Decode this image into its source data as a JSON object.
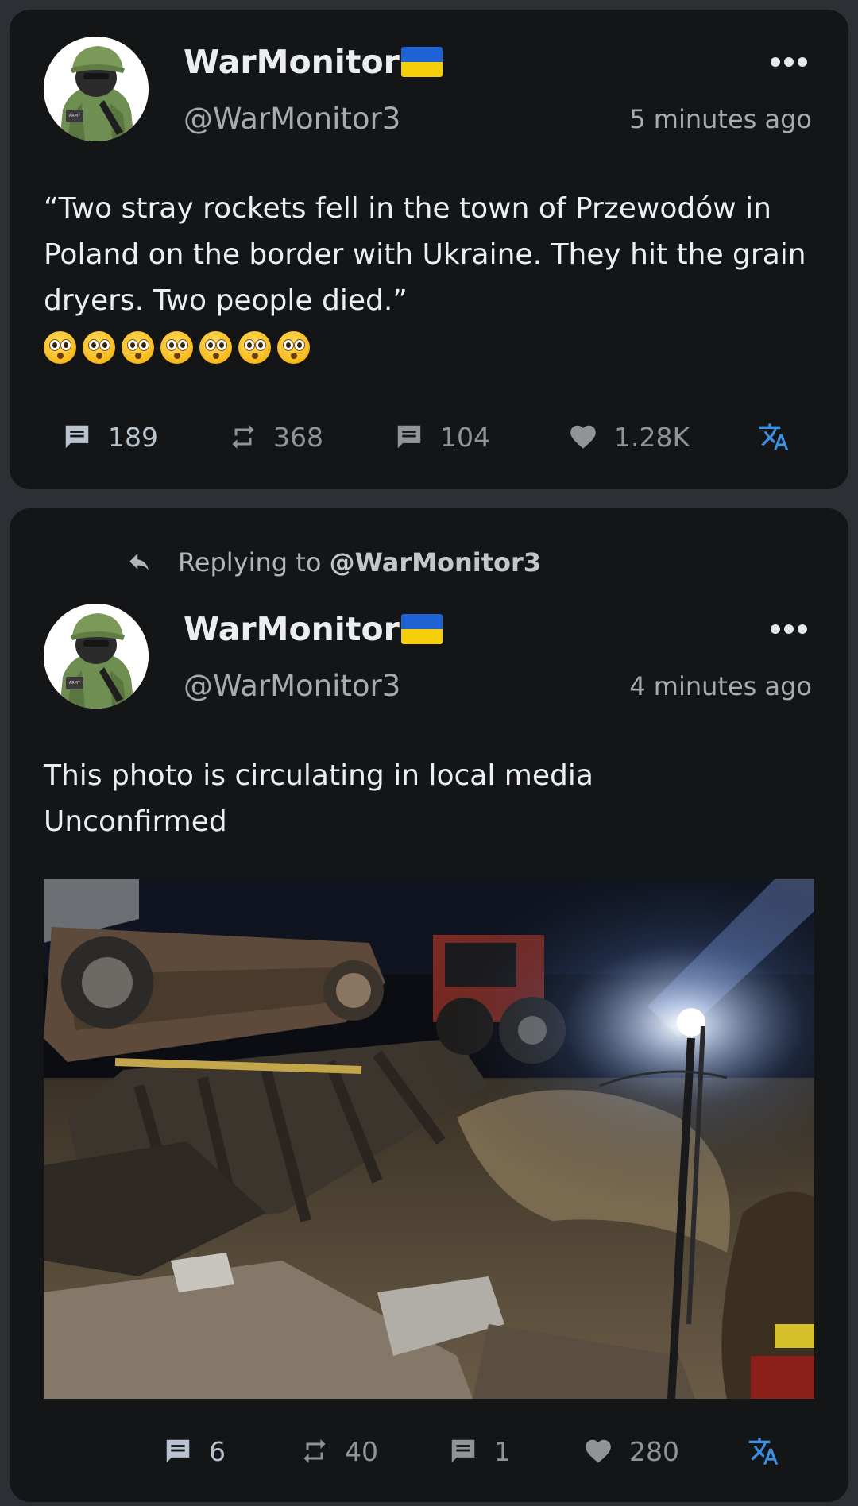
{
  "posts": [
    {
      "display_name": "WarMonitor",
      "name_flag_icon": "ukraine-flag-icon",
      "handle": "@WarMonitor3",
      "timestamp": "5 minutes ago",
      "avatar_icon": "soldier-avatar",
      "text_lines": [
        "“Two stray rockets fell in the town of Przewodów in",
        "Poland on the border with Ukraine. They hit the grain",
        "dryers. Two people died.”"
      ],
      "emoji": "flushed-face-emoji",
      "emoji_count": 7,
      "actions": {
        "replies": "189",
        "reposts": "368",
        "quotes": "104",
        "likes": "1.28K"
      }
    },
    {
      "reply_prefix": "Replying to",
      "reply_target": "@WarMonitor3",
      "display_name": "WarMonitor",
      "name_flag_icon": "ukraine-flag-icon",
      "handle": "@WarMonitor3",
      "timestamp": "4 minutes ago",
      "avatar_icon": "soldier-avatar",
      "text_lines": [
        "This photo is circulating in local media",
        "Unconfirmed"
      ],
      "media": "night photo of an overturned farm trailer and tractor beside a crater, lit by a floodlight",
      "actions": {
        "replies": "6",
        "reposts": "40",
        "quotes": "1",
        "likes": "280"
      }
    }
  ],
  "colors": {
    "background": "#2c3034",
    "card": "#141517",
    "text": "#eceef0",
    "secondary_text": "#a7abb0",
    "icon": "#8f9499",
    "primary_icon": "#b9c3d0",
    "translate_accent": "#3d8fe0"
  },
  "icons": [
    "more-options-icon",
    "reply-arrow-icon",
    "comment-icon",
    "repost-icon",
    "quote-icon",
    "heart-icon",
    "translate-icon"
  ]
}
